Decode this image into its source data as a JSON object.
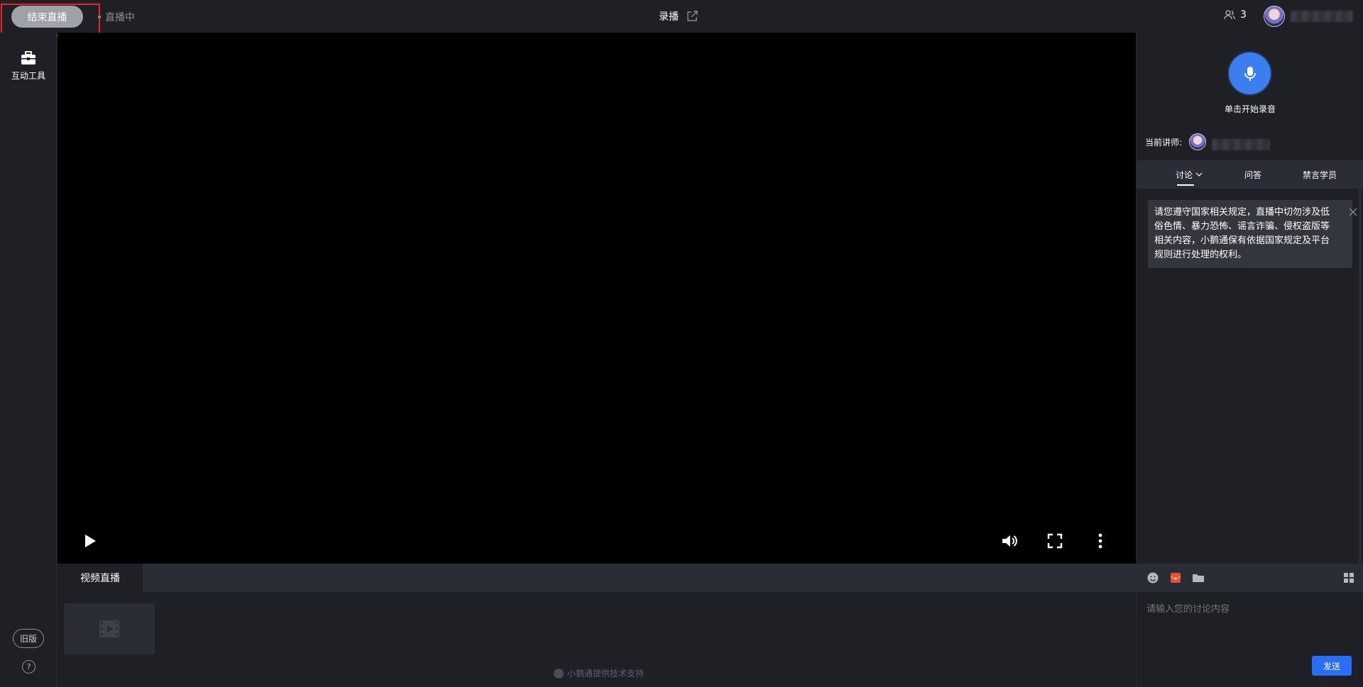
{
  "topbar": {
    "end_live_label": "结束直播",
    "live_status": "直播中",
    "title": "录播",
    "viewer_count": "3"
  },
  "leftrail": {
    "tool_label": "互动工具",
    "old_version_label": "旧版",
    "help_label": "?"
  },
  "player": {
    "bottom_tab_label": "视频直播",
    "powered_by": "小鹅通提供技术支持"
  },
  "rightpanel": {
    "mic_label": "单击开始录音",
    "lecturer_label": "当前讲师:",
    "tabs": [
      {
        "label": "讨论"
      },
      {
        "label": "问答"
      },
      {
        "label": "禁言学员"
      }
    ],
    "notice": "请您遵守国家相关规定，直播中切勿涉及低俗色情、暴力恐怖、谣言诈骗、侵权盗版等相关内容，小鹅通保有依据国家规定及平台规则进行处理的权利。",
    "input_placeholder": "请输入您的讨论内容",
    "send_label": "发送"
  },
  "colors": {
    "accent": "#3b7ef0",
    "send": "#2a6ef5",
    "highlight": "#e8262a"
  }
}
